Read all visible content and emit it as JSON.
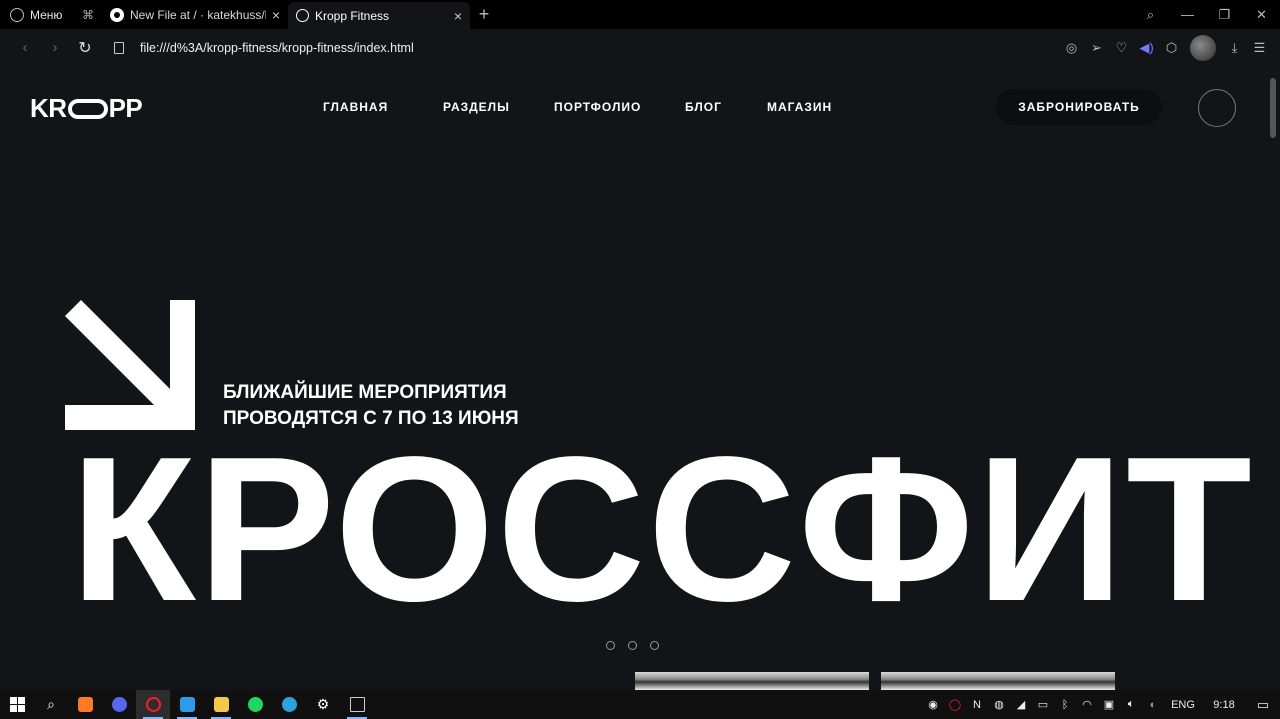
{
  "browser": {
    "menu_label": "Меню",
    "tabs": [
      {
        "title": "New File at / · katekhuss/kr"
      },
      {
        "title": "Kropp Fitness"
      }
    ],
    "new_tab": "+",
    "url": "file:///d%3A/kropp-fitness/kropp-fitness/index.html"
  },
  "site": {
    "logo_left": "KR",
    "logo_right": "PP",
    "nav": [
      "ГЛАВНАЯ",
      "РАЗДЕЛЫ",
      "ПОРТФОЛИО",
      "БЛОГ",
      "МАГАЗИН"
    ],
    "book_button": "ЗАБРОНИРОВАТЬ",
    "events_line1": "Ближайшие мероприятия",
    "events_line2": "проводятся с 7 по 13 июня",
    "hero_word": "КРОССФИТ",
    "slider": {
      "count": 3,
      "active_index": 0
    }
  },
  "taskbar": {
    "lang": "ENG",
    "time": "9:18"
  },
  "colors": {
    "page_bg": "#131418",
    "text": "#ffffff",
    "accent_volume": "#6f7dff"
  }
}
